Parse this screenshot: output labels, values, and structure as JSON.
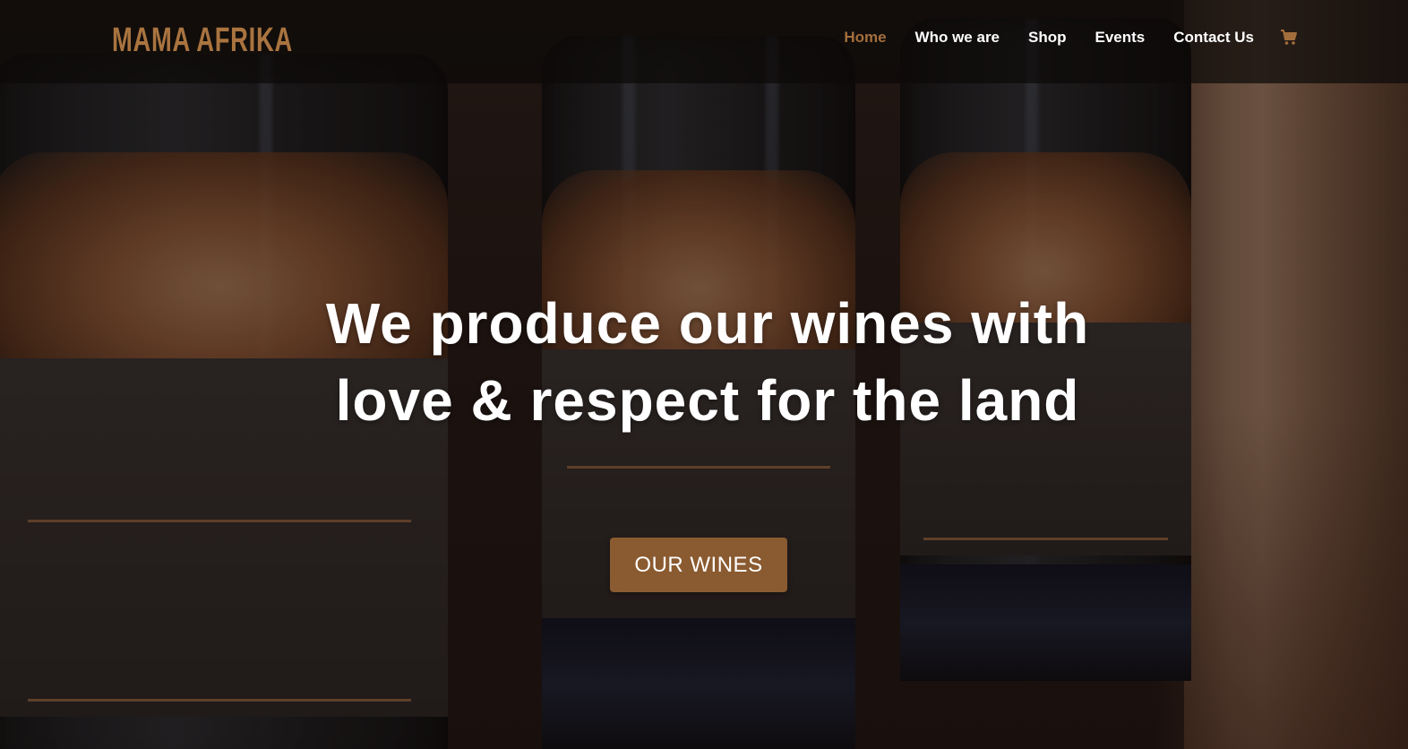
{
  "brand": {
    "logo_text": "MAMA AFRIKA",
    "accent_color": "#a36e3c",
    "button_color": "#8a5a30"
  },
  "nav": {
    "items": [
      {
        "label": "Home",
        "active": true
      },
      {
        "label": "Who we are",
        "active": false
      },
      {
        "label": "Shop",
        "active": false
      },
      {
        "label": "Events",
        "active": false
      },
      {
        "label": "Contact Us",
        "active": false
      }
    ],
    "cart_icon": "shopping-cart-icon"
  },
  "hero": {
    "title": "We produce our wines with love & respect for the land",
    "button_label": "OUR WINES",
    "background": "photo of Mama Afrika Malbec 2019 wine bottles with copper elephant labels"
  }
}
